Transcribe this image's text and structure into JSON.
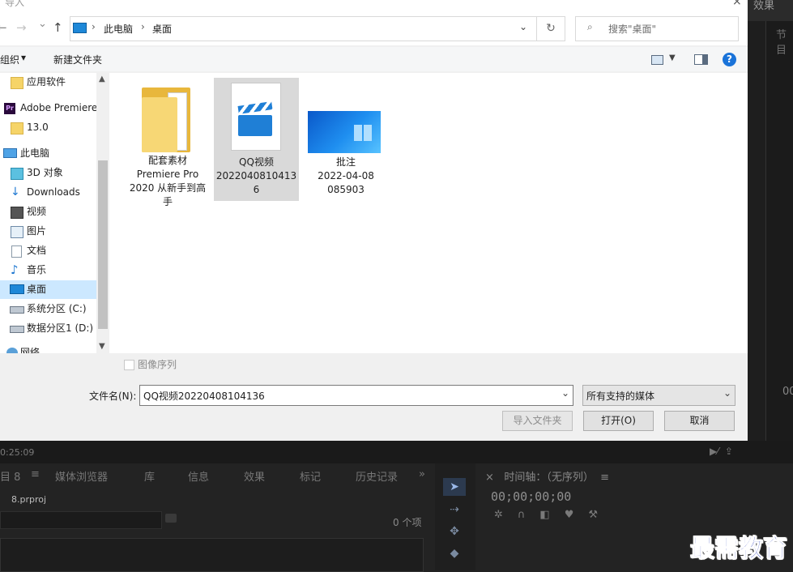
{
  "dialog": {
    "title": "导入",
    "close": "×",
    "nav": {
      "back": "←",
      "forward": "→",
      "dropdown": "⌄",
      "up": "↑"
    },
    "breadcrumb": [
      "此电脑",
      "桌面"
    ],
    "breadcrumb_sep": "›",
    "search_placeholder": "搜索\"桌面\"",
    "toolbar": {
      "organize": "组织",
      "organize_arrow": "▾",
      "new_folder": "新建文件夹",
      "help": "?"
    },
    "nav_pane": [
      {
        "label": "应用软件",
        "icon": "folder-icon"
      },
      {
        "label": "Adobe Premiere",
        "icon": "premiere-icon",
        "badge": "Pr"
      },
      {
        "label": "13.0",
        "icon": "folder-icon"
      },
      {
        "label": "此电脑",
        "icon": "computer-icon"
      },
      {
        "label": "3D 对象",
        "icon": "3d-objects-icon"
      },
      {
        "label": "Downloads",
        "icon": "download-icon"
      },
      {
        "label": "视频",
        "icon": "video-icon"
      },
      {
        "label": "图片",
        "icon": "picture-icon"
      },
      {
        "label": "文档",
        "icon": "document-icon"
      },
      {
        "label": "音乐",
        "icon": "music-icon"
      },
      {
        "label": "桌面",
        "icon": "desktop-icon",
        "selected": true
      },
      {
        "label": "系统分区 (C:)",
        "icon": "system-drive-icon"
      },
      {
        "label": "数据分区1 (D:)",
        "icon": "drive-icon"
      },
      {
        "label": "网络",
        "icon": "network-icon"
      }
    ],
    "files": [
      {
        "lines": [
          "配套素材",
          "Premiere Pro",
          "2020 从新手到高",
          "手"
        ],
        "type": "folder"
      },
      {
        "lines": [
          "QQ视频",
          "2022040810413",
          "6"
        ],
        "type": "video",
        "selected": true
      },
      {
        "lines": [
          "批注",
          "2022-04-08",
          "085903"
        ],
        "type": "image"
      }
    ],
    "image_sequence_label": "图像序列",
    "filename_label": "文件名(N):",
    "filename_value": "QQ视频20220408104136",
    "filetype_value": "所有支持的媒体",
    "buttons": {
      "import_folder": "导入文件夹",
      "open": "打开(O)",
      "cancel": "取消"
    }
  },
  "premiere": {
    "effects_title": "效果",
    "node_label": "节目",
    "timecode_right": "00",
    "time_left": "0:25:09",
    "project_tabs": [
      "目 8",
      "≡",
      "媒体浏览器",
      "库",
      "信息",
      "效果",
      "标记",
      "历史记录",
      "»"
    ],
    "project_file": "8.prproj",
    "item_count": "0 个项",
    "timeline_title": "时间轴：（无序列）",
    "timeline_menu": "≡",
    "timeline_close": "×",
    "timecode": "00;00;00;00"
  },
  "watermark": "最需教育",
  "colors": {
    "accent": "#0078d7",
    "selection": "#cce8ff",
    "watermark": "#1a2fb8"
  }
}
